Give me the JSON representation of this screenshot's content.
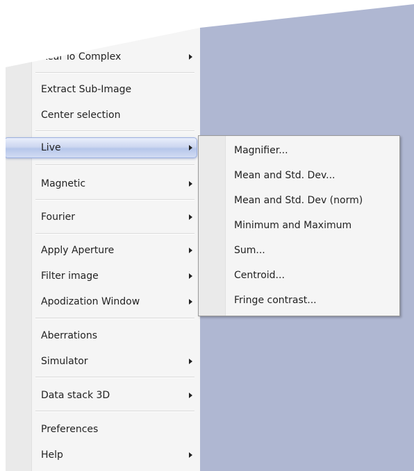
{
  "main_menu": {
    "items": [
      {
        "label": "Real To Complex",
        "has_submenu": true
      },
      {
        "label": "Extract Sub-Image",
        "has_submenu": false
      },
      {
        "label": "Center selection",
        "has_submenu": false
      },
      {
        "label": "Live",
        "has_submenu": true,
        "highlighted": true
      },
      {
        "label": "Magnetic",
        "has_submenu": true
      },
      {
        "label": "Fourier",
        "has_submenu": true
      },
      {
        "label": "Apply Aperture",
        "has_submenu": true
      },
      {
        "label": "Filter image",
        "has_submenu": true
      },
      {
        "label": "Apodization Window",
        "has_submenu": true
      },
      {
        "label": "Aberrations",
        "has_submenu": false
      },
      {
        "label": "Simulator",
        "has_submenu": true
      },
      {
        "label": "Data stack 3D",
        "has_submenu": true
      },
      {
        "label": "Preferences",
        "has_submenu": false
      },
      {
        "label": "Help",
        "has_submenu": true
      }
    ]
  },
  "live_submenu": {
    "items": [
      {
        "label": "Magnifier..."
      },
      {
        "label": "Mean and Std. Dev..."
      },
      {
        "label": "Mean and Std. Dev (norm)"
      },
      {
        "label": "Minimum and Maximum"
      },
      {
        "label": "Sum..."
      },
      {
        "label": "Centroid..."
      },
      {
        "label": "Fringe contrast..."
      }
    ]
  },
  "icons": {
    "submenu_arrow": "chevron-right-icon"
  },
  "colors": {
    "desktop_background": "#afb7d2",
    "menu_background": "#f5f5f5",
    "highlight": "#b6c6ea",
    "text": "#222222"
  }
}
